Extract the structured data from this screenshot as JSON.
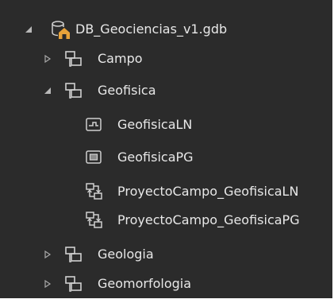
{
  "tree": {
    "root": {
      "label": "DB_Geociencias_v1.gdb",
      "expanded": true,
      "icon": "geodatabase-icon"
    },
    "items": [
      {
        "label": "Campo",
        "expanded": false,
        "icon": "feature-dataset-icon"
      },
      {
        "label": "Geofisica",
        "expanded": true,
        "icon": "feature-dataset-icon",
        "children": [
          {
            "label": "GeofisicaLN",
            "icon": "line-feature-class-icon"
          },
          {
            "label": "GeofisicaPG",
            "icon": "polygon-feature-class-icon"
          },
          {
            "label": "ProyectoCampo_GeofisicaLN",
            "icon": "relationship-class-icon"
          },
          {
            "label": "ProyectoCampo_GeofisicaPG",
            "icon": "relationship-class-icon"
          }
        ]
      },
      {
        "label": "Geologia",
        "expanded": false,
        "icon": "feature-dataset-icon"
      },
      {
        "label": "Geomorfologia",
        "expanded": false,
        "icon": "feature-dataset-icon"
      }
    ]
  },
  "colors": {
    "background": "#2b2b2b",
    "text": "#e8e8e8",
    "icon": "#d0d0d0",
    "home_accent": "#e8a33a"
  }
}
